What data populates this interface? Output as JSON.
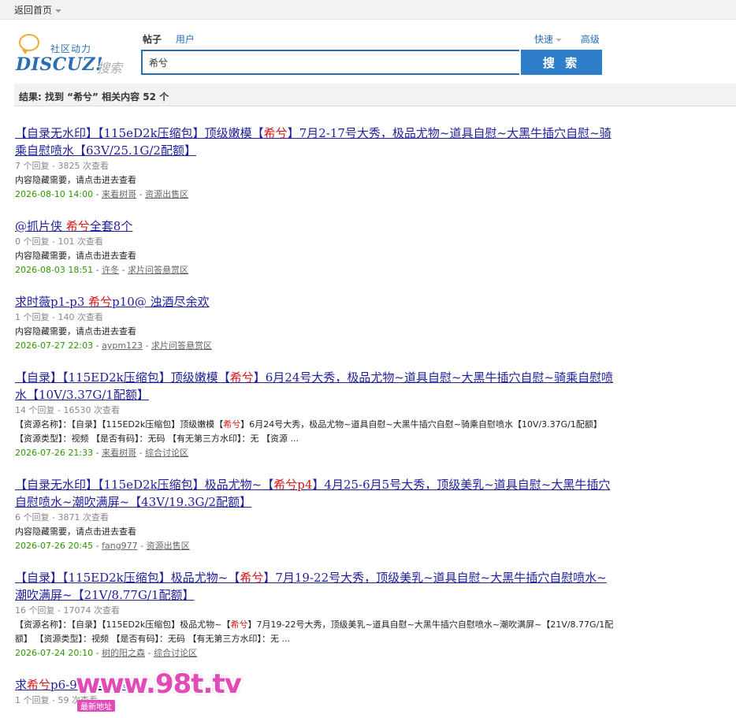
{
  "topbar": {
    "home_label": "返回首页"
  },
  "logo": {
    "slogan": "社区动力",
    "brand": "DISCUZ!",
    "brand_suffix": "搜索"
  },
  "tabs": [
    {
      "label": "帖子",
      "active": true
    },
    {
      "label": "用户",
      "active": false
    }
  ],
  "search": {
    "value": "希兮",
    "button_label": "搜 索",
    "quick_label": "快速",
    "advanced_label": "高级"
  },
  "result_summary": "结果: 找到 “希兮” 相关内容 52 个",
  "results": [
    {
      "title_pre": "【自录无水印】【115eD2k压缩包】顶级嫩模【",
      "title_hl": "希兮",
      "title_post": "】7月2-17号大秀，极品尤物~道具自慰~大黑牛插穴自慰~骑乘自慰喷水【63V/25.1G/2配额】",
      "meta": "7 个回复 - 3825 次查看",
      "desc": "内容隐藏需要，请点击进去查看",
      "date": "2026-08-10 14:00",
      "author": "来看树哥",
      "forum": "资源出售区"
    },
    {
      "title_pre": "@抓片侠 ",
      "title_hl": "希兮",
      "title_post": "全套8个",
      "meta": "0 个回复 - 101 次查看",
      "desc": "内容隐藏需要，请点击进去查看",
      "date": "2026-08-03 18:51",
      "author": "许冬",
      "forum": "求片问答悬赏区"
    },
    {
      "title_pre": "求时薇p1-p3 ",
      "title_hl": "希兮",
      "title_post": "p10@ 浊酒尽余欢",
      "meta": "1 个回复 - 140 次查看",
      "desc": "内容隐藏需要，请点击进去查看",
      "date": "2026-07-27 22:03",
      "author": "aypm123",
      "forum": "求片问答悬赏区"
    },
    {
      "title_pre": "【自录】【115ED2k压缩包】顶级嫩模【",
      "title_hl": "希兮",
      "title_post": "】6月24号大秀，极品尤物~道具自慰~大黑牛插穴自慰~骑乘自慰喷水【10V/3.37G/1配额】",
      "meta": "14 个回复 - 16530 次查看",
      "desc_pre": "【资源名称】：【自录】【115ED2k压缩包】顶级嫩模【",
      "desc_hl": "希兮",
      "desc_post": "】6月24号大秀，极品尤物~道具自慰~大黑牛插穴自慰~骑乘自慰喷水【10V/3.37G/1配额】 【资源类型】：视频 【是否有码】：无码 【有无第三方水印】：无 【资源 ...",
      "date": "2026-07-26 21:33",
      "author": "来看树哥",
      "forum": "综合讨论区"
    },
    {
      "title_pre": "【自录无水印】【115eD2k压缩包】极品尤物~【",
      "title_hl": "希兮p4",
      "title_post": "】4月25-6月5号大秀，顶级美乳~道具自慰~大黑牛插穴自慰喷水~潮吹满屏~【43V/19.3G/2配额】",
      "meta": "6 个回复 - 3871 次查看",
      "desc": "内容隐藏需要，请点击进去查看",
      "date": "2026-07-26 20:45",
      "author": "fang977",
      "forum": "资源出售区"
    },
    {
      "title_pre": "【自录】【115ED2k压缩包】极品尤物~【",
      "title_hl": "希兮",
      "title_post": "】7月19-22号大秀，顶级美乳~道具自慰~大黑牛插穴自慰喷水~潮吹满屏~【21V/8.77G/1配额】",
      "meta": "16 个回复 - 17074 次查看",
      "desc_pre": "【资源名称】：【自录】【115ED2k压缩包】极品尤物~【",
      "desc_hl": "希兮",
      "desc_post": "】7月19-22号大秀，顶级美乳~道具自慰~大黑牛插穴自慰喷水~潮吹满屏~【21V/8.77G/1配额】 【资源类型】：视频 【是否有码】：无码 【有无第三方水印】：无 ...",
      "date": "2026-07-24 20:10",
      "author": "树的阳之森",
      "forum": "综合讨论区"
    },
    {
      "title_pre": "求",
      "title_hl": "希兮",
      "title_post": "p6-9 浊酒尽余欢",
      "meta": "1 个回复 - 59 次查看",
      "desc": "",
      "date": "",
      "author": "",
      "forum": ""
    }
  ],
  "watermark": {
    "text": "www.98t.tv",
    "sub": "最新地址"
  },
  "colors": {
    "accent": "#2a6fb5",
    "button": "#2f7ec9",
    "highlight": "#d01616",
    "date": "#2e9500",
    "title": "#1f1f99"
  }
}
